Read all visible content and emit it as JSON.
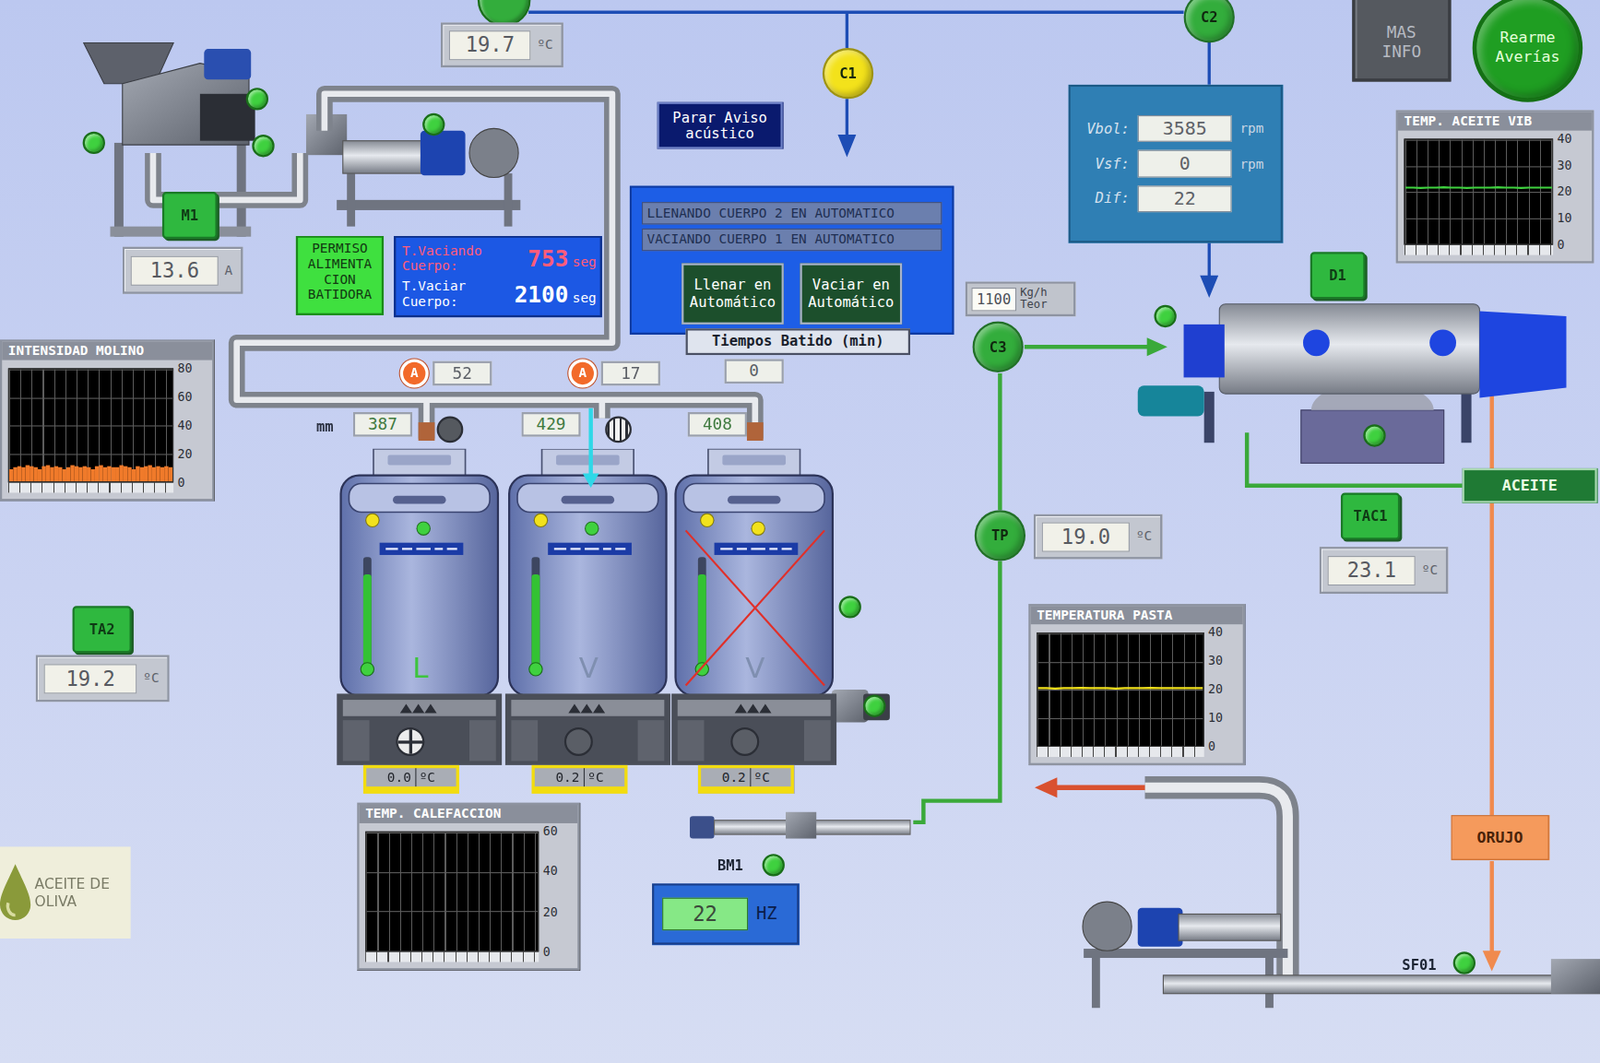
{
  "readings": {
    "top": {
      "value": "19.7",
      "unit": "ºC"
    },
    "mill_current": {
      "label": "M1",
      "value": "13.6",
      "unit": "A"
    },
    "ta2": {
      "label": "TA2",
      "value": "19.2",
      "unit": "ºC"
    },
    "tp": {
      "value": "19.0",
      "unit": "ºC"
    },
    "tac1": {
      "label": "TAC1",
      "value": "23.1",
      "unit": "ºC"
    },
    "flow": {
      "value": "1100",
      "unit": "Kg/h Teor"
    },
    "bm1": {
      "label": "BM1",
      "value": "22",
      "unit": "HZ"
    }
  },
  "valves": [
    {
      "label": "C1",
      "color": "#f3e21b"
    },
    {
      "label": "C2",
      "color": "#33ad3c"
    },
    {
      "label": "C3",
      "color": "#33ad3c"
    },
    {
      "label": "TP",
      "color": "#33ad3c"
    }
  ],
  "indicators": [
    {
      "color": "#33ad3c"
    },
    {
      "color": "#3fd13f"
    },
    {
      "color": "#3fd13f"
    },
    {
      "color": "#3fd13f"
    },
    {
      "color": "#3fd13f"
    },
    {
      "color": "#3fd13f"
    },
    {
      "color": "#3fd13f"
    },
    {
      "color": "#3fd13f"
    },
    {
      "color": "#3fd13f"
    },
    {
      "color": "#3fd13f"
    },
    {
      "color": "#3fd13f"
    }
  ],
  "buttons": {
    "mas_info": "MAS INFO",
    "rearme": "Rearme Averías",
    "parar_aviso": "Parar Aviso acústico",
    "llenar": "Llenar en Automático",
    "vaciar": "Vaciar en Automático"
  },
  "permiso": "PERMISO ALIMENTACION BATIDORA",
  "timer": {
    "rows": [
      {
        "label": "T.Vaciando Cuerpo:",
        "value": "753",
        "unit": "seg",
        "color": "#ff5c7a"
      },
      {
        "label": "T.Vaciar Cuerpo:",
        "value": "2100",
        "unit": "seg",
        "color": "#ffffff"
      }
    ]
  },
  "auto_panel": {
    "status": [
      "LLENANDO CUERPO 2 EN AUTOMATICO",
      "VACIANDO CUERPO 1 EN AUTOMATICO"
    ]
  },
  "decanter": {
    "label": "D1",
    "rows": [
      {
        "label": "Vbol:",
        "value": "3585",
        "unit": "rpm"
      },
      {
        "label": "Vsf:",
        "value": "0",
        "unit": "rpm"
      },
      {
        "label": "Dif:",
        "value": "22"
      }
    ]
  },
  "beaters": {
    "title": "Tiempos Batido (min)",
    "unit_mm": "mm",
    "alarm_text": "A",
    "items": [
      {
        "mm": "387",
        "batido": "52",
        "alarm": true,
        "mode": "L",
        "mode_color": "#3ec43e",
        "temp": "0.0",
        "temp_unit": "ºC",
        "level": 0.85,
        "inlet_valve_open": false,
        "outlet_valve_open": true,
        "filling": false,
        "disabled": false,
        "dots": [
          {
            "color": "#f2e21c"
          },
          {
            "color": "#3fd13f"
          }
        ]
      },
      {
        "mm": "429",
        "batido": "17",
        "alarm": true,
        "mode": "V",
        "mode_color": "#7f8fb0",
        "temp": "0.2",
        "temp_unit": "ºC",
        "level": 0.85,
        "inlet_valve_open": true,
        "outlet_valve_open": false,
        "filling": true,
        "disabled": false,
        "dots": [
          {
            "color": "#f2e21c"
          },
          {
            "color": "#3fd13f"
          }
        ]
      },
      {
        "mm": "408",
        "batido": "0",
        "alarm": false,
        "mode": "V",
        "mode_color": "#7f8fb0",
        "temp": "0.2",
        "temp_unit": "ºC",
        "level": 0.85,
        "inlet_valve_open": null,
        "outlet_valve_open": false,
        "filling": false,
        "disabled": true,
        "dots": [
          {
            "color": "#f2e21c"
          },
          {
            "color": "#f2e21c"
          }
        ]
      }
    ]
  },
  "charts": [
    {
      "title": "INTENSIDAD MOLINO",
      "kind": "area",
      "ticks": [
        "80",
        "60",
        "40",
        "20",
        "0"
      ],
      "series": [
        {
          "color": "#f07a2a",
          "values": [
            9,
            10,
            11,
            10,
            12,
            11,
            10,
            9,
            11,
            12,
            10,
            11,
            10,
            9,
            10,
            12,
            11,
            10,
            11,
            10,
            9,
            11,
            12,
            10,
            11,
            10,
            10,
            12,
            11,
            10,
            9,
            11,
            10,
            11,
            12,
            10,
            11,
            10,
            11,
            10
          ]
        }
      ]
    },
    {
      "title": "TEMP. ACEITE VIB",
      "kind": "line",
      "ticks": [
        "40",
        "30",
        "20",
        "10",
        "0"
      ],
      "series": [
        {
          "color": "#3fd13f",
          "values": [
            21.6,
            21.6,
            21.5,
            21.6,
            21.6,
            21.7,
            21.6,
            21.6,
            21.5,
            21.6,
            21.6,
            21.6,
            21.7,
            21.6,
            21.6,
            21.5,
            21.6,
            21.6,
            21.6,
            21.6
          ]
        }
      ]
    },
    {
      "title": "TEMP. CALEFACCION",
      "kind": "line",
      "ticks": [
        "60",
        "40",
        "20",
        "0"
      ],
      "series": []
    },
    {
      "title": "TEMPERATURA PASTA",
      "kind": "line",
      "ticks": [
        "40",
        "30",
        "20",
        "10",
        "0"
      ],
      "series": [
        {
          "color": "#f2e21c",
          "values": [
            20.5,
            20.5,
            20.4,
            20.5,
            20.5,
            20.6,
            20.5,
            20.5,
            20.5,
            20.4,
            20.5,
            20.5,
            20.5,
            20.6,
            20.5,
            20.5,
            20.5,
            20.5,
            20.5,
            20.5
          ]
        }
      ]
    }
  ],
  "streams": {
    "aceite": "ACEITE",
    "orujo": "ORUJO",
    "sf01": "SF01"
  },
  "logo": "ACEITE DE OLIVA"
}
